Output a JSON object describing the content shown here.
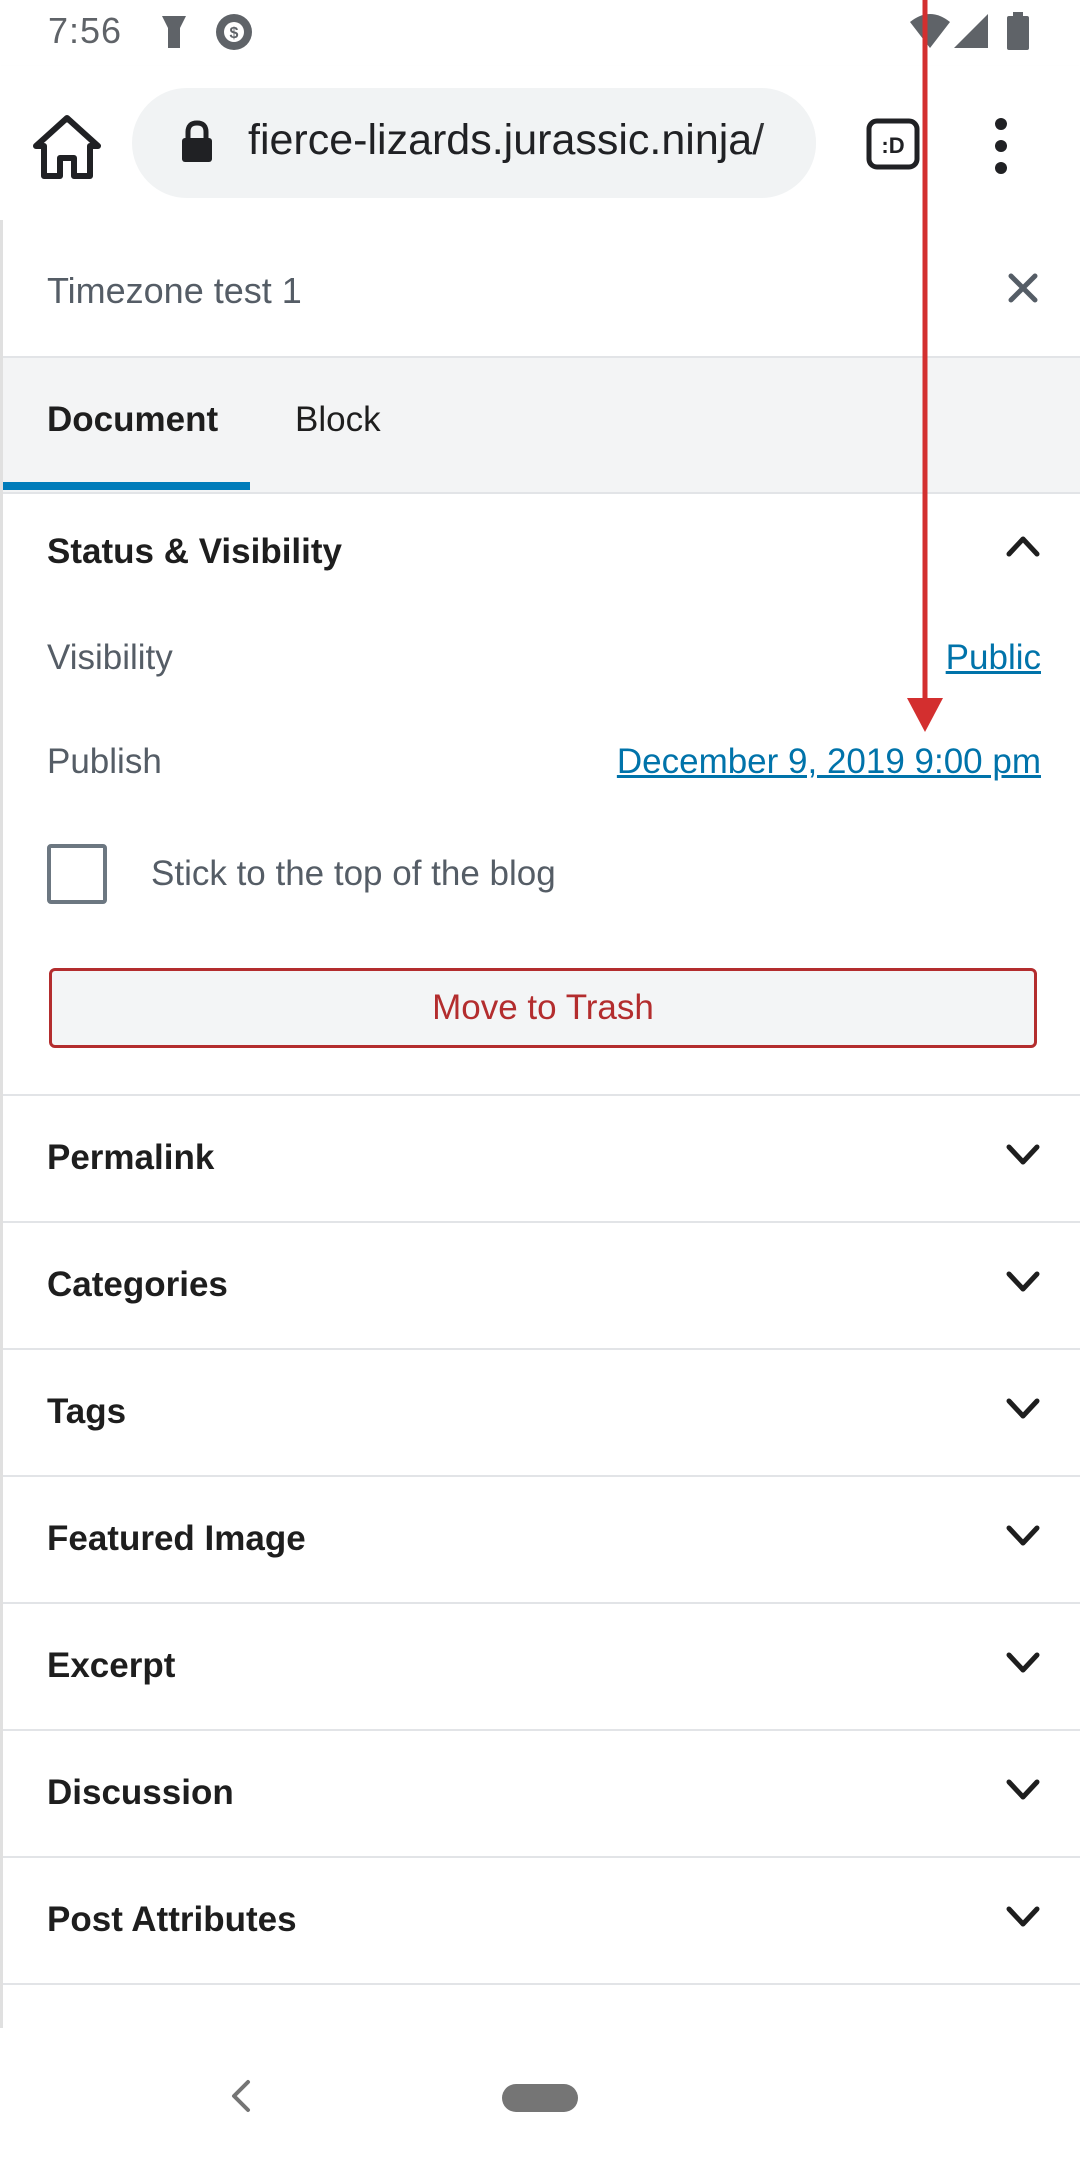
{
  "status_bar": {
    "time": "7:56"
  },
  "browser": {
    "url": "fierce-lizards.jurassic.ninja/"
  },
  "sidebar": {
    "title": "Timezone test 1",
    "tabs": [
      {
        "label": "Document",
        "active": true
      },
      {
        "label": "Block",
        "active": false
      }
    ],
    "status_visibility": {
      "title": "Status & Visibility",
      "visibility_label": "Visibility",
      "visibility_value": "Public",
      "publish_label": "Publish",
      "publish_value": "December 9, 2019 9:00 pm",
      "sticky_label": "Stick to the top of the blog",
      "sticky_checked": false,
      "trash_button": "Move to Trash"
    },
    "sections": [
      {
        "label": "Permalink"
      },
      {
        "label": "Categories"
      },
      {
        "label": "Tags"
      },
      {
        "label": "Featured Image"
      },
      {
        "label": "Excerpt"
      },
      {
        "label": "Discussion"
      },
      {
        "label": "Post Attributes"
      }
    ]
  },
  "colors": {
    "accent": "#007cba",
    "link": "#0073aa",
    "danger": "#b32d2e",
    "annotation_arrow": "#d32f2f"
  }
}
